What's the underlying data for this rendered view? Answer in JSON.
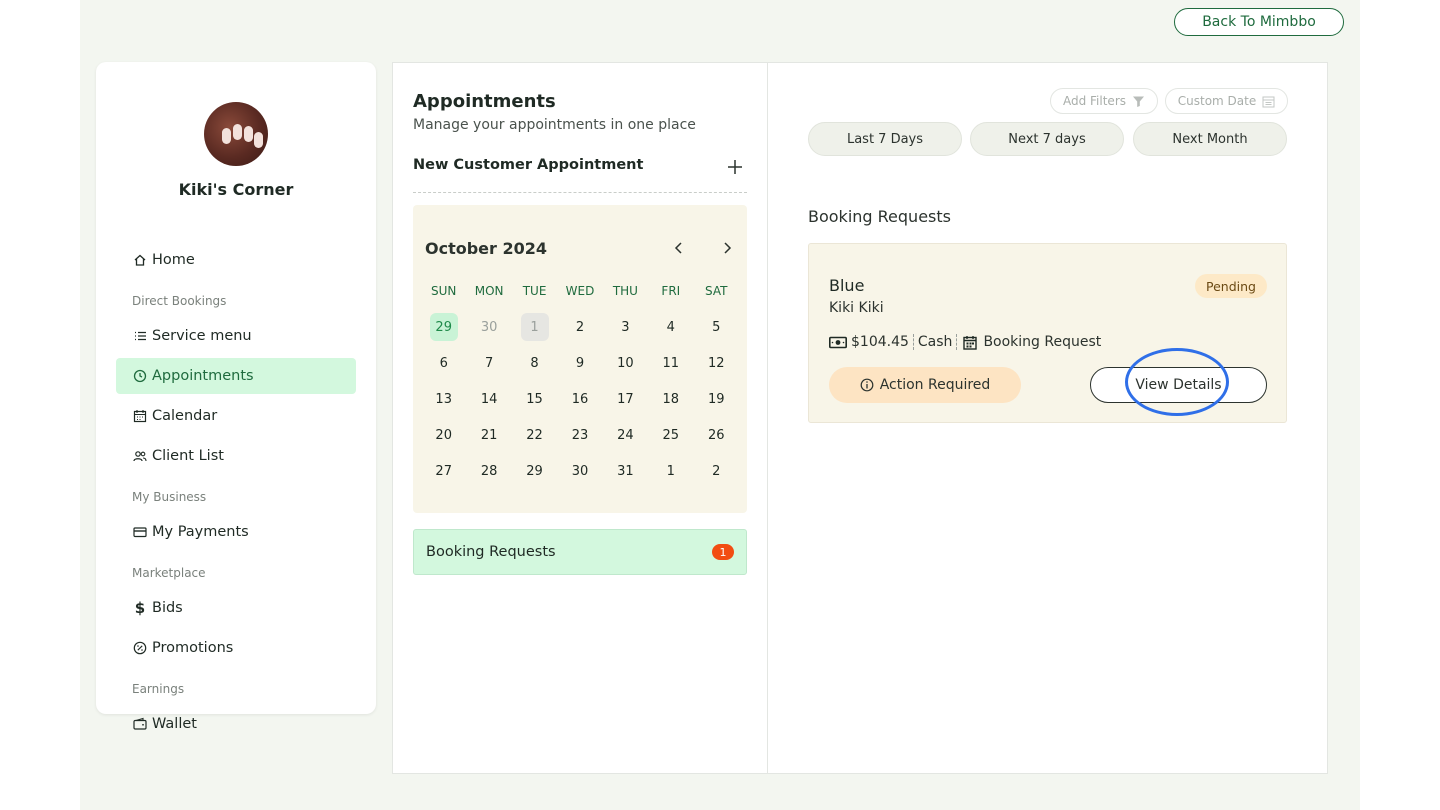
{
  "header": {
    "back_label": "Back To Mimbbo"
  },
  "sidebar": {
    "business_name": "Kiki's Corner",
    "items": [
      {
        "label": "Home",
        "icon": "home-icon"
      },
      {
        "label": "Service menu",
        "icon": "list-icon"
      },
      {
        "label": "Appointments",
        "icon": "clock-icon",
        "active": true
      },
      {
        "label": "Calendar",
        "icon": "calendar-icon"
      },
      {
        "label": "Client List",
        "icon": "users-icon"
      },
      {
        "label": "My Payments",
        "icon": "card-icon"
      },
      {
        "label": "Bids",
        "icon": "dollar-icon"
      },
      {
        "label": "Promotions",
        "icon": "percent-badge-icon"
      },
      {
        "label": "Wallet",
        "icon": "wallet-icon"
      }
    ],
    "sections": [
      "Direct Bookings",
      "My Business",
      "Marketplace",
      "Earnings"
    ]
  },
  "appointments": {
    "title": "Appointments",
    "subtitle": "Manage your appointments in one place",
    "new_label": "New Customer Appointment"
  },
  "calendar": {
    "month_label": "October 2024",
    "weekdays": [
      "SUN",
      "MON",
      "TUE",
      "WED",
      "THU",
      "FRI",
      "SAT"
    ],
    "weeks": [
      [
        "29",
        "30",
        "1",
        "2",
        "3",
        "4",
        "5"
      ],
      [
        "6",
        "7",
        "8",
        "9",
        "10",
        "11",
        "12"
      ],
      [
        "13",
        "14",
        "15",
        "16",
        "17",
        "18",
        "19"
      ],
      [
        "20",
        "21",
        "22",
        "23",
        "24",
        "25",
        "26"
      ],
      [
        "27",
        "28",
        "29",
        "30",
        "31",
        "1",
        "2"
      ]
    ],
    "selected": "29",
    "today": "1"
  },
  "booking_bar": {
    "label": "Booking Requests",
    "count": "1"
  },
  "filters": {
    "add_filters": "Add Filters",
    "custom_date": "Custom Date",
    "ranges": [
      "Last 7 Days",
      "Next 7 days",
      "Next Month"
    ]
  },
  "requests": {
    "title": "Booking Requests",
    "card": {
      "service": "Blue",
      "client": "Kiki Kiki",
      "status": "Pending",
      "price": "$104.45",
      "payment": "Cash",
      "type": "Booking Request",
      "action": "Action Required",
      "view": "View Details"
    }
  },
  "colors": {
    "brand_green": "#1f6b3e",
    "active_bg": "#d3f8de",
    "badge_orange": "#f24d12",
    "highlight_blue": "#2f6fe8"
  }
}
